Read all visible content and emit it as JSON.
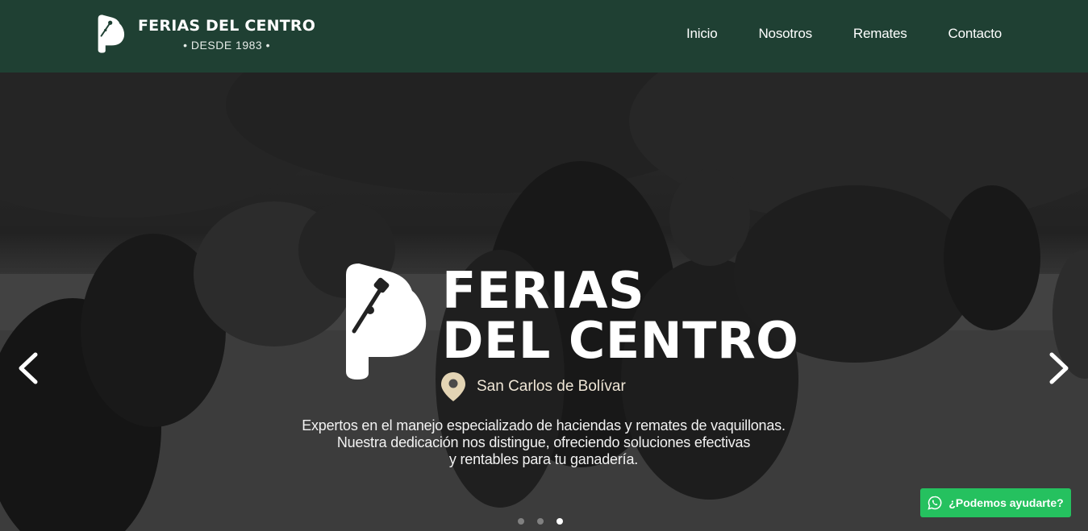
{
  "header": {
    "brand_name": "FERIAS DEL CENTRO",
    "brand_sub": "• DESDE 1983 •",
    "logo_icon": "hoof-brand-icon",
    "bg_color": "#1f4033"
  },
  "nav": {
    "items": [
      {
        "label": "Inicio"
      },
      {
        "label": "Nosotros"
      },
      {
        "label": "Remates"
      },
      {
        "label": "Contacto"
      }
    ]
  },
  "hero": {
    "title_line1": "FERIAS",
    "title_line2": "DEL CENTRO",
    "location": "San Carlos de Bolívar",
    "location_icon": "map-pin-icon",
    "desc_line1": "Expertos en el manejo especializado de haciendas y remates de vaquillonas.",
    "desc_line2": "Nuestra dedicación nos distingue, ofreciendo soluciones efectivas",
    "desc_line3": "y rentables para tu ganadería.",
    "background": "grayscale photo of black cattle in a pasture",
    "slides_total": 3,
    "active_slide": 3
  },
  "whatsapp": {
    "label": "¿Podemos ayudarte?",
    "icon": "whatsapp-icon",
    "color": "#25c15f"
  }
}
